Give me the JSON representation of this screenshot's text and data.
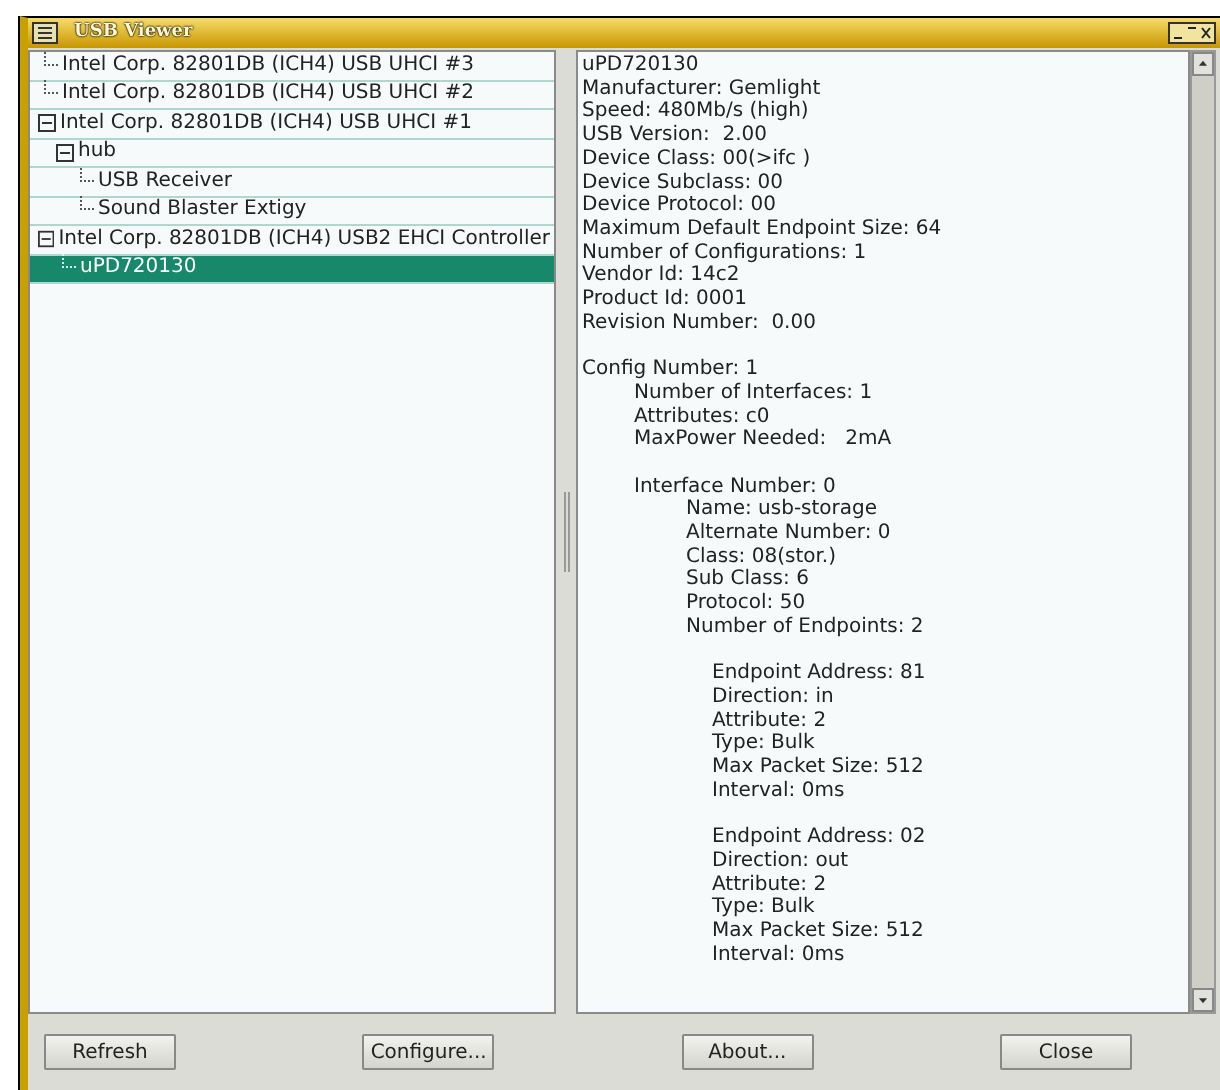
{
  "window": {
    "title": "USB Viewer"
  },
  "tree": [
    {
      "label": "Intel Corp. 82801DB (ICH4) USB UHCI #3",
      "selected": false
    },
    {
      "label": "Intel Corp. 82801DB (ICH4) USB UHCI #2",
      "selected": false
    },
    {
      "label": "Intel Corp. 82801DB (ICH4) USB UHCI #1",
      "selected": false,
      "expanded": true,
      "children": [
        {
          "label": "hub",
          "selected": false,
          "expanded": true,
          "children": [
            {
              "label": "USB Receiver",
              "selected": false
            },
            {
              "label": "Sound Blaster Extigy",
              "selected": false
            }
          ]
        }
      ]
    },
    {
      "label": "Intel Corp. 82801DB (ICH4) USB2 EHCI Controller",
      "selected": false,
      "expanded": true,
      "children": [
        {
          "label": "uPD720130",
          "selected": true
        }
      ]
    }
  ],
  "details": [
    {
      "kind": "line",
      "text": "uPD720130"
    },
    {
      "kind": "line",
      "text": "Manufacturer: Gemlight"
    },
    {
      "kind": "line",
      "text": "Speed: 480Mb/s (high)"
    },
    {
      "kind": "line",
      "text": "USB Version:  2.00"
    },
    {
      "kind": "line",
      "text": "Device Class: 00(>ifc )"
    },
    {
      "kind": "line",
      "text": "Device Subclass: 00"
    },
    {
      "kind": "line",
      "text": "Device Protocol: 00"
    },
    {
      "kind": "line",
      "text": "Maximum Default Endpoint Size: 64"
    },
    {
      "kind": "line",
      "text": "Number of Configurations: 1"
    },
    {
      "kind": "line",
      "text": "Vendor Id: 14c2"
    },
    {
      "kind": "line",
      "text": "Product Id: 0001"
    },
    {
      "kind": "line",
      "text": "Revision Number:  0.00"
    },
    {
      "kind": "section",
      "text": "Config Number: 1",
      "children": [
        {
          "kind": "line",
          "text": "Number of Interfaces: 1"
        },
        {
          "kind": "line",
          "text": "Attributes: c0"
        },
        {
          "kind": "line",
          "text": "MaxPower Needed:   2mA"
        },
        {
          "kind": "section",
          "text": "Interface Number: 0",
          "children": [
            {
              "kind": "line",
              "text": "Name: usb-storage"
            },
            {
              "kind": "line",
              "text": "Alternate Number: 0"
            },
            {
              "kind": "line",
              "text": "Class: 08(stor.)"
            },
            {
              "kind": "line",
              "text": "Sub Class: 6"
            },
            {
              "kind": "line",
              "text": "Protocol: 50"
            },
            {
              "kind": "line",
              "text": "Number of Endpoints: 2"
            },
            {
              "kind": "block",
              "lines": [
                "Endpoint Address: 81",
                "Direction: in",
                "Attribute: 2",
                "Type: Bulk",
                "Max Packet Size: 512",
                "Interval: 0ms"
              ]
            },
            {
              "kind": "block",
              "lines": [
                "Endpoint Address: 02",
                "Direction: out",
                "Attribute: 2",
                "Type: Bulk",
                "Max Packet Size: 512",
                "Interval: 0ms"
              ]
            }
          ]
        }
      ]
    }
  ],
  "buttons": [
    "Refresh",
    "Configure...",
    "About...",
    "Close"
  ]
}
